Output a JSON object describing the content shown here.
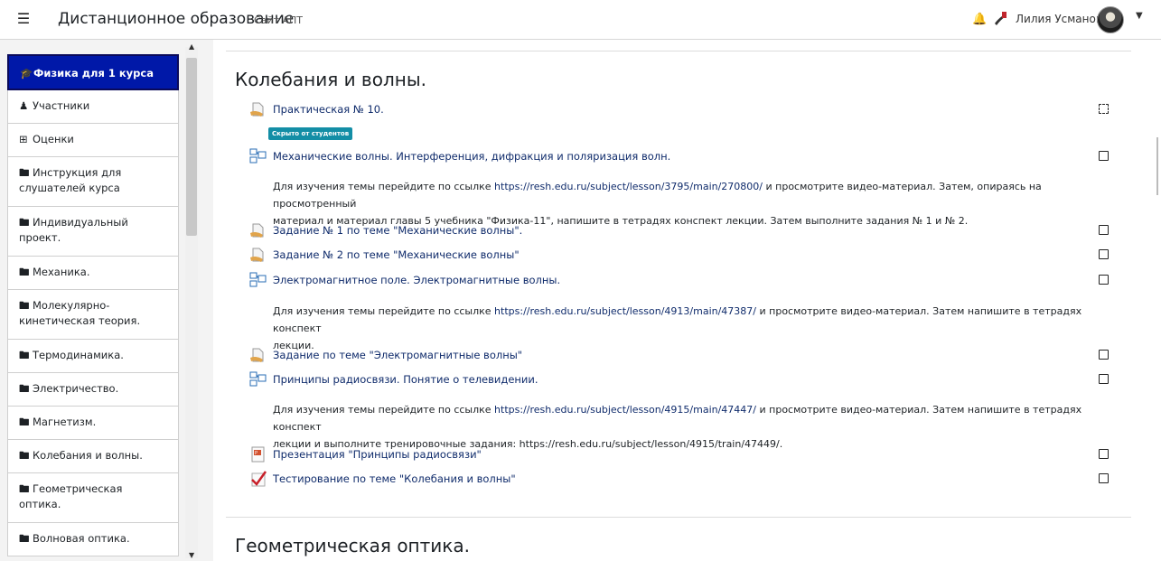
{
  "header": {
    "brand": "Дистанционное образование",
    "site_link": "Сайт АПТ",
    "user_name": "Лилия Усманова"
  },
  "sidebar": {
    "items": [
      {
        "label": "Физика для 1 курса",
        "icon": "graduation-cap-icon",
        "active": true
      },
      {
        "label": "Участники",
        "icon": "users-icon"
      },
      {
        "label": "Оценки",
        "icon": "table-icon"
      },
      {
        "label": "Инструкция для слушателей курса",
        "icon": "folder-icon"
      },
      {
        "label": "Индивидуальный проект.",
        "icon": "folder-icon"
      },
      {
        "label": "Механика.",
        "icon": "folder-icon"
      },
      {
        "label": "Молекулярно-кинетическая теория.",
        "icon": "folder-icon"
      },
      {
        "label": "Термодинамика.",
        "icon": "folder-icon"
      },
      {
        "label": "Электричество.",
        "icon": "folder-icon"
      },
      {
        "label": "Магнетизм.",
        "icon": "folder-icon"
      },
      {
        "label": "Колебания и волны.",
        "icon": "folder-icon"
      },
      {
        "label": "Геометрическая оптика.",
        "icon": "folder-icon"
      },
      {
        "label": "Волновая оптика.",
        "icon": "folder-icon"
      }
    ]
  },
  "main": {
    "section_title": "Колебания и волны.",
    "hidden_badge": "Скрыто от студентов",
    "activities": [
      {
        "label": "Практическая № 10.",
        "icon": "assignment-icon"
      },
      {
        "label": "Механические волны. Интерференция, дифракция и поляризация волн.",
        "icon": "book-icon"
      },
      {
        "label": "Задание № 1 по теме \"Механические волны\".",
        "icon": "assignment-icon"
      },
      {
        "label": "Задание № 2 по теме \"Механические волны\"",
        "icon": "assignment-icon"
      },
      {
        "label": "Электромагнитное поле. Электромагнитные волны.",
        "icon": "book-icon"
      },
      {
        "label": "Задание по теме \"Электромагнитные волны\"",
        "icon": "assignment-icon"
      },
      {
        "label": "Принципы радиосвязи. Понятие о телевидении.",
        "icon": "book-icon"
      },
      {
        "label": "Презентация \"Принципы радиосвязи\"",
        "icon": "presentation-icon"
      },
      {
        "label": "Тестирование по теме \"Колебания и волны\"",
        "icon": "quiz-icon"
      }
    ],
    "desc1": {
      "pre": "Для изучения темы перейдите по ссылке ",
      "url": "https://resh.edu.ru/subject/lesson/3795/main/270800/",
      "post": " и просмотрите видео-материал. Затем, опираясь на просмотренный",
      "line2": "материал и материал главы 5 учебника \"Физика-11\", напишите в тетрадях конспект лекции. Затем выполните задания № 1 и № 2."
    },
    "desc2": {
      "pre": "Для изучения темы перейдите по ссылке ",
      "url": "https://resh.edu.ru/subject/lesson/4913/main/47387/",
      "post": " и просмотрите видео-материал. Затем напишите в тетрадях конспект",
      "line2": "лекции."
    },
    "desc3": {
      "pre": "Для изучения темы перейдите по ссылке ",
      "url": "https://resh.edu.ru/subject/lesson/4915/main/47447/",
      "post": " и просмотрите видео-материал. Затем напишите в тетрадях конспект",
      "line2": "лекции и выполните тренировочные задания: https://resh.edu.ru/subject/lesson/4915/train/47449/."
    },
    "next_section_title": "Геометрическая оптика."
  }
}
